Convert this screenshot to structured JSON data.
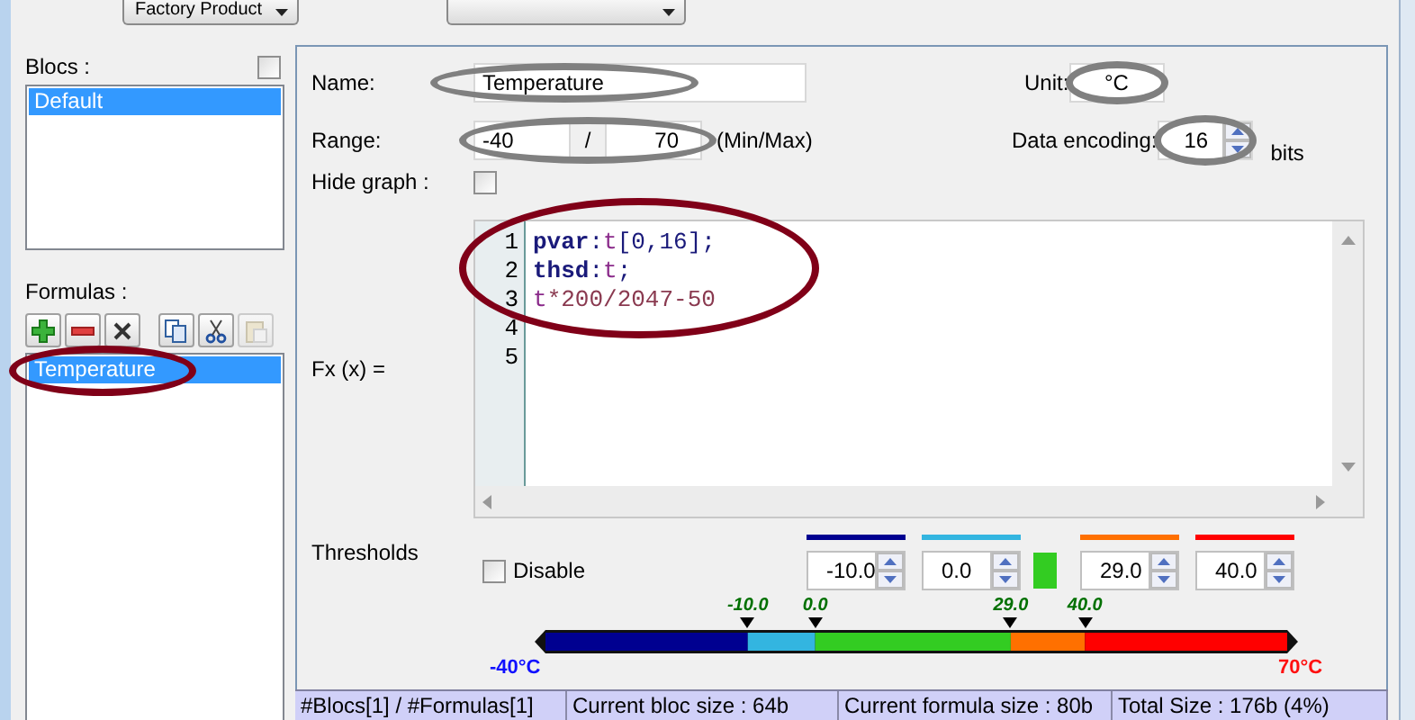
{
  "top_bar": {
    "dropdowns": [
      {
        "kind": "dropdown",
        "label": "Factory Product"
      },
      {
        "kind": "dropdown"
      }
    ]
  },
  "blocs": {
    "label": "Blocs :",
    "checked": false,
    "items": [
      {
        "label": "Default",
        "selected": true
      }
    ]
  },
  "formulas": {
    "label": "Formulas :",
    "toolbar": [
      {
        "kind": "add",
        "disabled": false
      },
      {
        "kind": "remove",
        "disabled": false
      },
      {
        "kind": "delete",
        "disabled": false
      },
      {
        "kind": "copy",
        "disabled": false
      },
      {
        "kind": "cut",
        "disabled": false
      },
      {
        "kind": "paste",
        "disabled": true
      }
    ],
    "items": [
      {
        "label": "Temperature",
        "selected": true,
        "circled": true
      }
    ]
  },
  "form": {
    "name": {
      "label": "Name:",
      "value": "Temperature",
      "circled": true
    },
    "unit": {
      "label": "Unit:",
      "value": "°C",
      "circled": true
    },
    "range": {
      "label": "Range:",
      "min": "-40",
      "separator": "/",
      "max": "70",
      "hint": "(Min/Max)",
      "circled": true
    },
    "encoding": {
      "label": "Data encoding:",
      "value": "16",
      "suffix": "bits",
      "circled": true
    },
    "hide_graph": {
      "label": "Hide graph :",
      "checked": false
    },
    "formula": {
      "label": "Fx (x) =",
      "circled": true,
      "lines": [
        {
          "number": "1",
          "tokens": [
            {
              "text": "pvar",
              "kind": "keyword"
            },
            {
              "text": ":",
              "kind": "punct"
            },
            {
              "text": "t",
              "kind": "var"
            },
            {
              "text": "[0,16];",
              "kind": "punct"
            }
          ]
        },
        {
          "number": "2",
          "tokens": [
            {
              "text": "thsd",
              "kind": "keyword"
            },
            {
              "text": ":",
              "kind": "punct"
            },
            {
              "text": "t",
              "kind": "var"
            },
            {
              "text": ";",
              "kind": "punct"
            }
          ]
        },
        {
          "number": "3",
          "tokens": [
            {
              "text": "t",
              "kind": "var"
            },
            {
              "text": "*200/2047-50",
              "kind": "expr"
            }
          ]
        },
        {
          "number": "4"
        },
        {
          "number": "5"
        }
      ]
    }
  },
  "thresholds": {
    "label": "Thresholds",
    "disable": {
      "label": "Disable",
      "checked": false
    },
    "middle": {
      "color": "#33cc22"
    },
    "items": [
      {
        "value": "-10.0",
        "color": "#000090"
      },
      {
        "value": "0.0",
        "color": "#33b5e0"
      },
      {
        "value": "29.0",
        "color": "#ff7000"
      },
      {
        "value": "40.0",
        "color": "#ff0000"
      }
    ],
    "scale": {
      "min_label": "-40°C",
      "max_label": "70°C",
      "markers": [
        "-10.0",
        "0.0",
        "29.0",
        "40.0"
      ]
    }
  },
  "status_bar": [
    "#Blocs[1] / #Formulas[1]",
    "Current bloc size : 64b",
    "Current formula size : 80b",
    "Total Size : 176b (4%)"
  ]
}
